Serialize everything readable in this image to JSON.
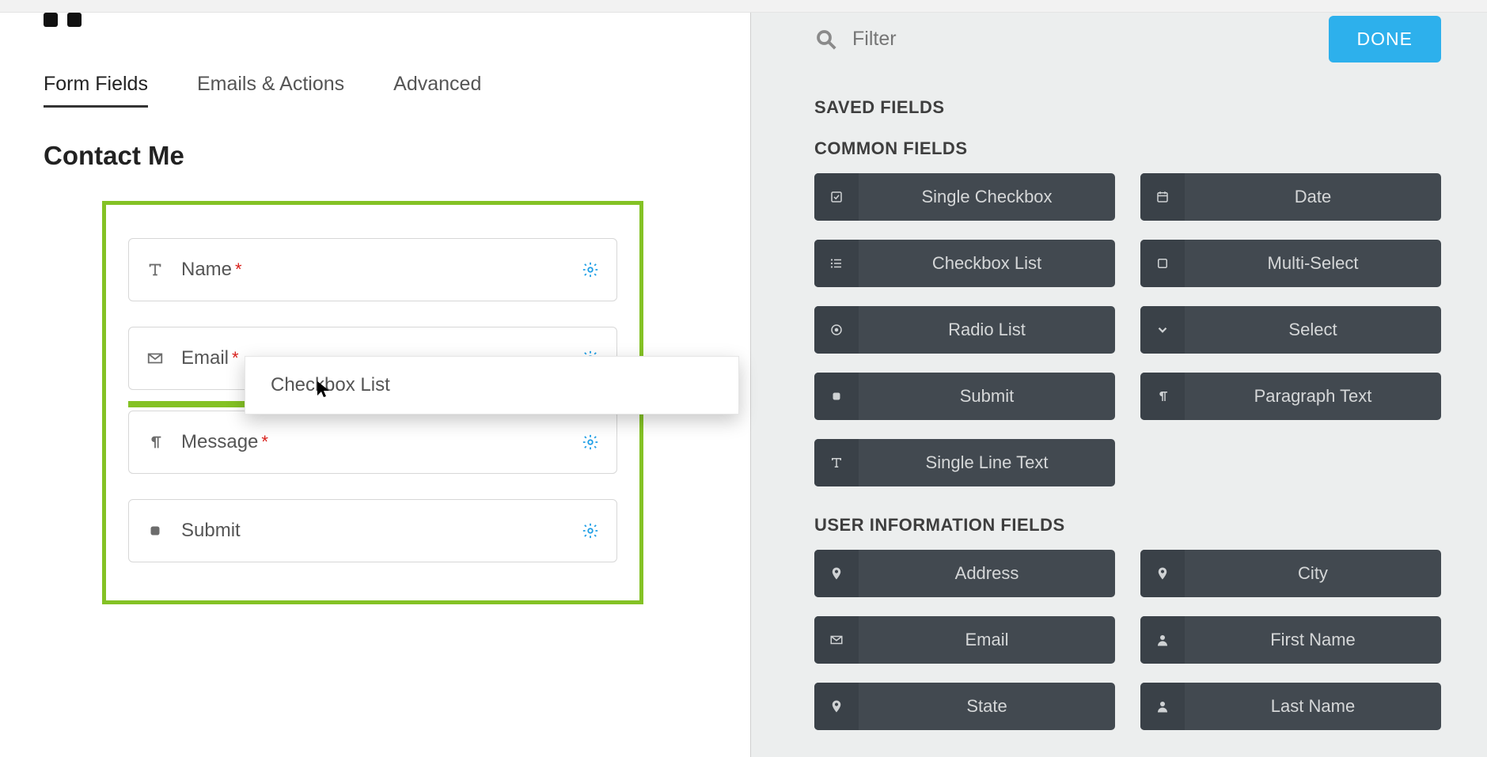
{
  "colors": {
    "accent": "#84c225",
    "primary_btn": "#2db0ec",
    "gear": "#1f9fe6",
    "required": "#d9201b"
  },
  "tabs": {
    "items": [
      "Form Fields",
      "Emails & Actions",
      "Advanced"
    ],
    "active": 0
  },
  "form": {
    "title": "Contact Me",
    "fields": [
      {
        "icon": "text-icon",
        "label": "Name",
        "required": true
      },
      {
        "icon": "envelope-icon",
        "label": "Email",
        "required": true
      },
      {
        "icon": "paragraph-icon",
        "label": "Message",
        "required": true
      },
      {
        "icon": "square-icon",
        "label": "Submit",
        "required": false
      }
    ],
    "drop_indicator_after_index": 1
  },
  "drag_ghost": {
    "label": "Checkbox List"
  },
  "right": {
    "filter_placeholder": "Filter",
    "done_label": "DONE",
    "sections": [
      {
        "title": "SAVED FIELDS",
        "items": []
      },
      {
        "title": "COMMON FIELDS",
        "items": [
          {
            "icon": "check-square-icon",
            "label": "Single Checkbox"
          },
          {
            "icon": "calendar-icon",
            "label": "Date"
          },
          {
            "icon": "list-icon",
            "label": "Checkbox List"
          },
          {
            "icon": "square-o-icon",
            "label": "Multi-Select"
          },
          {
            "icon": "radio-icon",
            "label": "Radio List"
          },
          {
            "icon": "chevron-down-icon",
            "label": "Select"
          },
          {
            "icon": "square-icon",
            "label": "Submit"
          },
          {
            "icon": "paragraph-icon",
            "label": "Paragraph Text"
          },
          {
            "icon": "text-icon",
            "label": "Single Line Text"
          }
        ]
      },
      {
        "title": "USER INFORMATION FIELDS",
        "items": [
          {
            "icon": "pin-icon",
            "label": "Address"
          },
          {
            "icon": "pin-icon",
            "label": "City"
          },
          {
            "icon": "envelope-icon",
            "label": "Email"
          },
          {
            "icon": "user-icon",
            "label": "First Name"
          },
          {
            "icon": "pin-icon",
            "label": "State"
          },
          {
            "icon": "user-icon",
            "label": "Last Name"
          }
        ]
      }
    ]
  }
}
